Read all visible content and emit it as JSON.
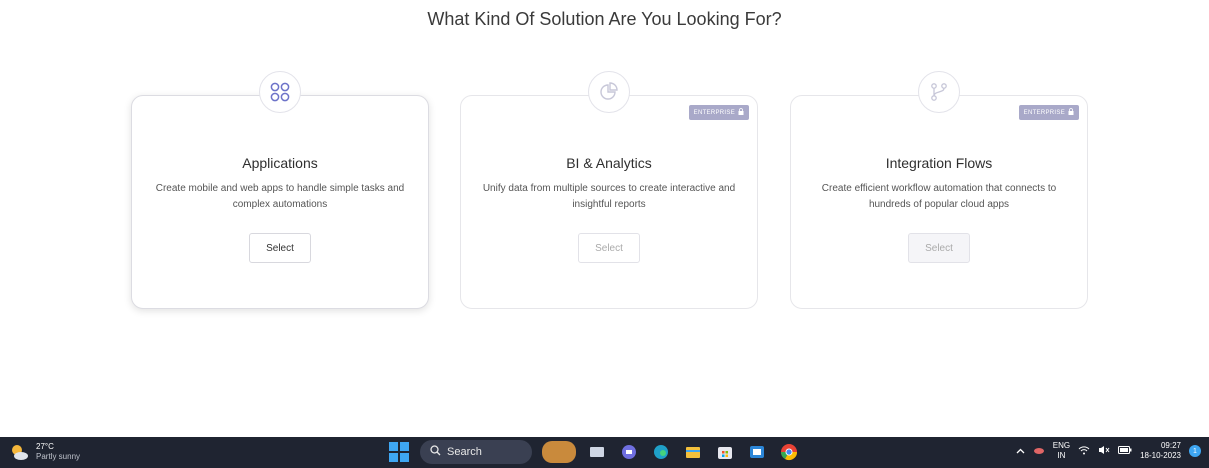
{
  "page": {
    "title": "What Kind Of Solution Are You Looking For?"
  },
  "cards": [
    {
      "icon": "apps-grid-icon",
      "title": "Applications",
      "description": "Create mobile and web apps to handle simple tasks and complex automations",
      "button": "Select",
      "badge": ""
    },
    {
      "icon": "pie-chart-icon",
      "title": "BI & Analytics",
      "description": "Unify data from multiple sources to create interactive and insightful reports",
      "button": "Select",
      "badge": "ENTERPRISE"
    },
    {
      "icon": "flow-branch-icon",
      "title": "Integration Flows",
      "description": "Create efficient workflow automation that connects to hundreds of popular cloud apps",
      "button": "Select",
      "badge": "ENTERPRISE"
    }
  ],
  "colors": {
    "accent_icon": "#6d73c9",
    "badge_bg": "#a9a9c9",
    "taskbar_bg": "#1f2431"
  },
  "taskbar": {
    "weather_temp": "27°C",
    "weather_desc": "Partly sunny",
    "search_label": "Search",
    "lang_top": "ENG",
    "lang_bottom": "IN",
    "time": "09:27",
    "date": "18-10-2023",
    "notification_count": "1"
  }
}
